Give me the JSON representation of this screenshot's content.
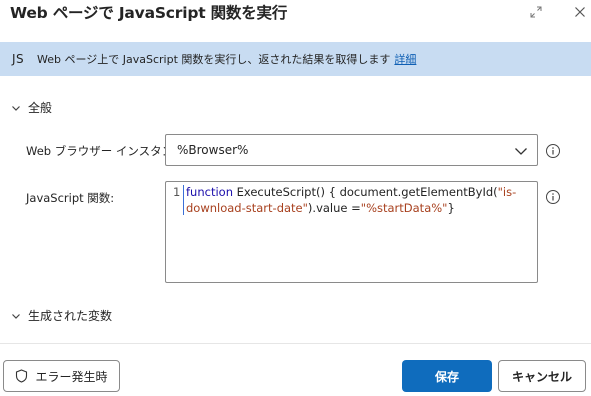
{
  "dialog": {
    "title": "Web ページで JavaScript 関数を実行"
  },
  "banner": {
    "badge": "JS",
    "description": "Web ページ上で JavaScript 関数を実行し、返された結果を取得します",
    "link": "詳細"
  },
  "sections": {
    "general": "全般",
    "variables": "生成された変数"
  },
  "fields": {
    "browser_label": "Web ブラウザー インスタンス:",
    "browser_value": "%Browser%",
    "function_label": "JavaScript 関数:",
    "line_number": "1",
    "code": {
      "keyword": "function",
      "part1": " ExecuteScript() { document.getElementById(",
      "string1": "\"is-download-start-date\"",
      "part2": ").value =",
      "string2": "\"%startData%\"",
      "part3": "}"
    }
  },
  "footer": {
    "error_button": "エラー発生時",
    "save_button": "保存",
    "cancel_button": "キャンセル"
  },
  "colors": {
    "banner_bg": "#c8dcf2",
    "primary": "#0f6cbd",
    "link": "#0f5fb4",
    "keyword": "#1a0dab",
    "string": "#a8411f"
  },
  "icons": [
    "expand-icon",
    "close-icon",
    "chevron-down-icon",
    "info-icon",
    "shield-icon"
  ]
}
